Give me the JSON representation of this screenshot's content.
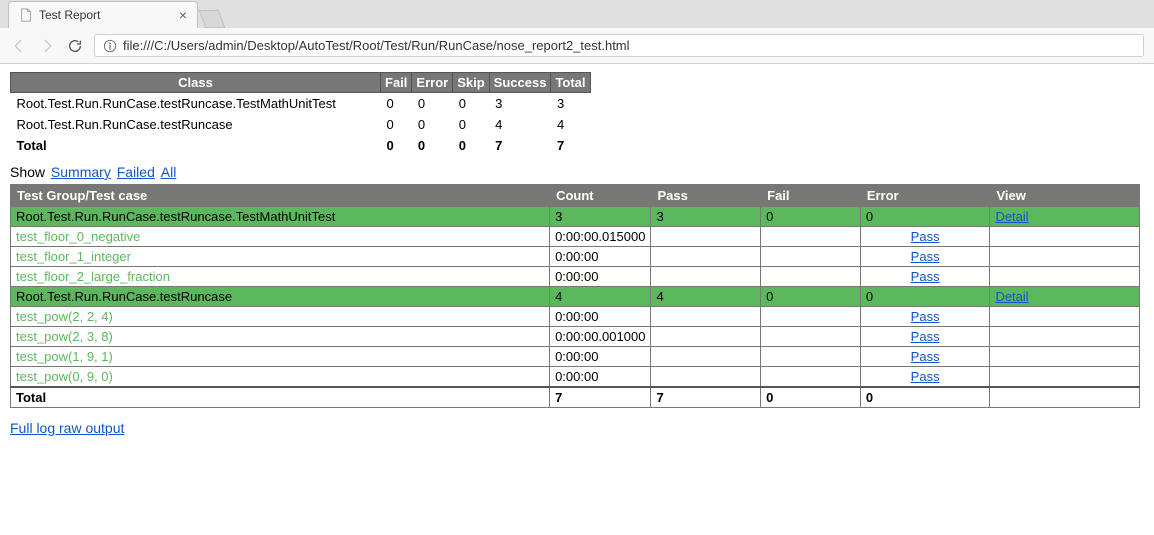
{
  "browser": {
    "tab_title": "Test Report",
    "url_proto": "file:///",
    "url_path": "C:/Users/admin/Desktop/AutoTest/Root/Test/Run/RunCase/nose_report2_test.html"
  },
  "summary": {
    "headers": [
      "Class",
      "Fail",
      "Error",
      "Skip",
      "Success",
      "Total"
    ],
    "rows": [
      {
        "class": "Root.Test.Run.RunCase.testRuncase.TestMathUnitTest",
        "fail": "0",
        "error": "0",
        "skip": "0",
        "success": "3",
        "total": "3"
      },
      {
        "class": "Root.Test.Run.RunCase.testRuncase",
        "fail": "0",
        "error": "0",
        "skip": "0",
        "success": "4",
        "total": "4"
      }
    ],
    "total": {
      "class": "Total",
      "fail": "0",
      "error": "0",
      "skip": "0",
      "success": "7",
      "total": "7"
    }
  },
  "filter": {
    "label": "Show",
    "summary": "Summary",
    "failed": "Failed",
    "all": "All"
  },
  "detail": {
    "headers": [
      "Test Group/Test case",
      "Count",
      "Pass",
      "Fail",
      "Error",
      "View"
    ],
    "groups": [
      {
        "name": "Root.Test.Run.RunCase.testRuncase.TestMathUnitTest",
        "count": "3",
        "pass": "3",
        "fail": "0",
        "error": "0",
        "view": "Detail",
        "cases": [
          {
            "name": "test_floor_0_negative",
            "duration": "0:00:00.015000",
            "result": "Pass"
          },
          {
            "name": "test_floor_1_integer",
            "duration": "0:00:00",
            "result": "Pass"
          },
          {
            "name": "test_floor_2_large_fraction",
            "duration": "0:00:00",
            "result": "Pass"
          }
        ]
      },
      {
        "name": "Root.Test.Run.RunCase.testRuncase",
        "count": "4",
        "pass": "4",
        "fail": "0",
        "error": "0",
        "view": "Detail",
        "cases": [
          {
            "name": "test_pow(2, 2, 4)",
            "duration": "0:00:00",
            "result": "Pass"
          },
          {
            "name": "test_pow(2, 3, 8)",
            "duration": "0:00:00.001000",
            "result": "Pass"
          },
          {
            "name": "test_pow(1, 9, 1)",
            "duration": "0:00:00",
            "result": "Pass"
          },
          {
            "name": "test_pow(0, 9, 0)",
            "duration": "0:00:00",
            "result": "Pass"
          }
        ]
      }
    ],
    "total": {
      "name": "Total",
      "count": "7",
      "pass": "7",
      "fail": "0",
      "error": "0"
    }
  },
  "raw_link": "Full log raw output"
}
